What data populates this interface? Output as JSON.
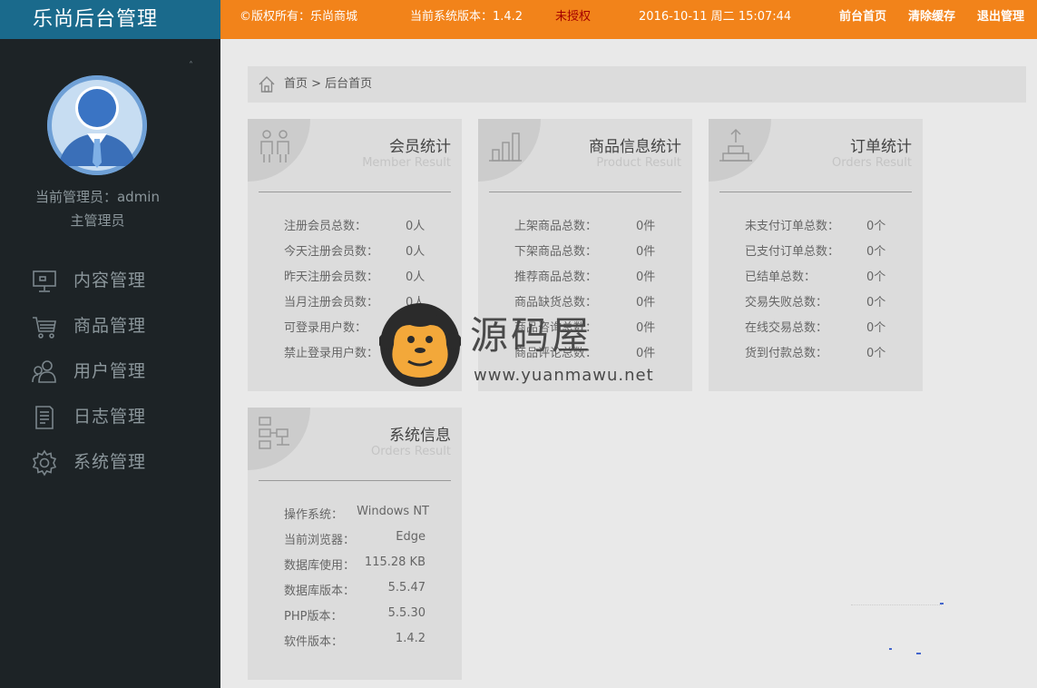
{
  "app": {
    "title": "乐尚后台管理"
  },
  "topbar": {
    "copyright": "©版权所有：乐尚商城",
    "version": "当前系统版本：1.4.2",
    "license": "未授权",
    "datetime": "2016-10-11 周二 15:07:44",
    "links": [
      "前台首页",
      "清除缓存",
      "退出管理"
    ]
  },
  "sidebar": {
    "collapse_glyph": "˄",
    "current_admin": "当前管理员：admin",
    "role": "主管理员",
    "menu": [
      {
        "label": "内容管理",
        "icon": "monitor-icon"
      },
      {
        "label": "商品管理",
        "icon": "cart-icon"
      },
      {
        "label": "用户管理",
        "icon": "users-icon"
      },
      {
        "label": "日志管理",
        "icon": "document-icon"
      },
      {
        "label": "系统管理",
        "icon": "gear-icon"
      }
    ]
  },
  "breadcrumb": {
    "text": "首页 > 后台首页",
    "icon": "home-icon"
  },
  "cards": {
    "member": {
      "title": "会员统计",
      "subtitle": "Member Result",
      "rows": [
        {
          "k": "注册会员总数：",
          "v": "0人"
        },
        {
          "k": "今天注册会员数：",
          "v": "0人"
        },
        {
          "k": "昨天注册会员数：",
          "v": "0人"
        },
        {
          "k": "当月注册会员数：",
          "v": "0人"
        },
        {
          "k": "可登录用户数：",
          "v": "0人"
        },
        {
          "k": "禁止登录用户数：",
          "v": "0人"
        }
      ]
    },
    "product": {
      "title": "商品信息统计",
      "subtitle": "Product Result",
      "rows": [
        {
          "k": "上架商品总数：",
          "v": "0件"
        },
        {
          "k": "下架商品总数：",
          "v": "0件"
        },
        {
          "k": "推荐商品总数：",
          "v": "0件"
        },
        {
          "k": "商品缺货总数：",
          "v": "0件"
        },
        {
          "k": "商品咨询总数：",
          "v": "0件"
        },
        {
          "k": "商品评论总数：",
          "v": "0件"
        }
      ]
    },
    "orders": {
      "title": "订单统计",
      "subtitle": "Orders Result",
      "rows": [
        {
          "k": "未支付订单总数：",
          "v": "0个"
        },
        {
          "k": "已支付订单总数：",
          "v": "0个"
        },
        {
          "k": "已结单总数：",
          "v": "0个"
        },
        {
          "k": "交易失败总数：",
          "v": "0个"
        },
        {
          "k": "在线交易总数：",
          "v": "0个"
        },
        {
          "k": "货到付款总数：",
          "v": "0个"
        }
      ]
    },
    "system": {
      "title": "系统信息",
      "subtitle": "Orders Result",
      "rows": [
        {
          "k": "操作系统：",
          "v": "Windows NT"
        },
        {
          "k": "当前浏览器：",
          "v": "Edge"
        },
        {
          "k": "数据库使用：",
          "v": "115.28 KB"
        },
        {
          "k": "数据库版本：",
          "v": "5.5.47"
        },
        {
          "k": "PHP版本：",
          "v": "5.5.30"
        },
        {
          "k": "软件版本：",
          "v": "1.4.2"
        }
      ]
    }
  },
  "watermark": {
    "text": "源码屋",
    "url": "www.yuanmawu.net"
  }
}
